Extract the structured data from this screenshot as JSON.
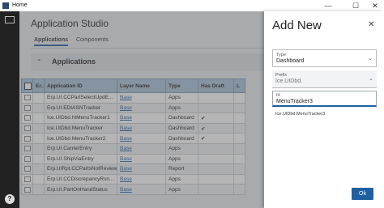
{
  "window": {
    "title": "Home",
    "minimize": "—",
    "maximize": "☐",
    "close": "✕"
  },
  "app": {
    "title": "Application Studio"
  },
  "tabs": [
    {
      "label": "Applications"
    },
    {
      "label": "Components"
    }
  ],
  "section": {
    "title": "Applications"
  },
  "grid": {
    "columns": [
      "Er...",
      "Application ID",
      "Layer Name",
      "Type",
      "Has Draft",
      "L"
    ],
    "rows": [
      {
        "id": "Erp.UI.CCPartSelectUpdE...",
        "layer": "Base",
        "type": "Apps",
        "draft": ""
      },
      {
        "id": "Erp.UI.EDIASNTracker",
        "layer": "Base",
        "type": "Apps",
        "draft": ""
      },
      {
        "id": "Ice.UIDbd.htMenuTracker1",
        "layer": "Base",
        "type": "Dashboard",
        "draft": "✔"
      },
      {
        "id": "Ice.UIDbd.MenuTracker",
        "layer": "Base",
        "type": "Dashboard",
        "draft": "✔"
      },
      {
        "id": "Ice.UIDbd.MenuTracker2",
        "layer": "Base",
        "type": "Dashboard",
        "draft": "✔"
      },
      {
        "id": "Erp.UI.CarrierEntry",
        "layer": "Base",
        "type": "Apps",
        "draft": ""
      },
      {
        "id": "Erp.UI.ShipViaEntry",
        "layer": "Base",
        "type": "Apps",
        "draft": ""
      },
      {
        "id": "Erp.UIRpt.CCPartsNotReviewed",
        "layer": "Base",
        "type": "Report",
        "draft": ""
      },
      {
        "id": "Erp.UI.CCDiscrepancyRsn...",
        "layer": "Base",
        "type": "Apps",
        "draft": ""
      },
      {
        "id": "Erp.UI.PartOnHandStatus",
        "layer": "Base",
        "type": "Apps",
        "draft": ""
      }
    ]
  },
  "panel": {
    "title": "Add New",
    "close_icon": "✕",
    "type": {
      "label": "Type",
      "value": "Dashboard"
    },
    "prefix": {
      "label": "Prefix",
      "value": "Ice.UIDbd."
    },
    "id": {
      "label": "Id",
      "value": "MenuTracker3"
    },
    "full_id": "Ice.UIDbd.MenuTracker3",
    "ok_label": "Ok"
  },
  "help_icon": "?"
}
